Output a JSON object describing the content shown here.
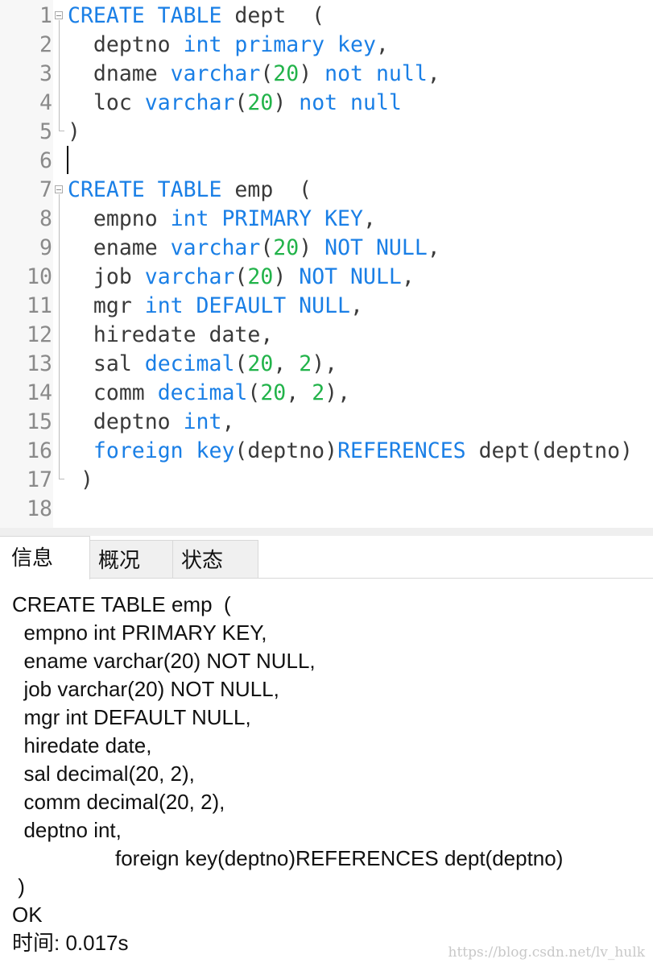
{
  "editor": {
    "lines": [
      [
        [
          "CREATE TABLE",
          "kw"
        ],
        [
          " dept  (",
          ""
        ]
      ],
      [
        [
          "  deptno ",
          ""
        ],
        [
          "int primary key",
          "kw"
        ],
        [
          ",",
          ""
        ]
      ],
      [
        [
          "  dname ",
          ""
        ],
        [
          "varchar",
          "kw"
        ],
        [
          "(",
          ""
        ],
        [
          "20",
          "num"
        ],
        [
          ") ",
          ""
        ],
        [
          "not null",
          "kw"
        ],
        [
          ",",
          ""
        ]
      ],
      [
        [
          "  loc ",
          ""
        ],
        [
          "varchar",
          "kw"
        ],
        [
          "(",
          ""
        ],
        [
          "20",
          "num"
        ],
        [
          ") ",
          ""
        ],
        [
          "not null",
          "kw"
        ]
      ],
      [
        [
          ")",
          ""
        ]
      ],
      [],
      [
        [
          "CREATE TABLE",
          "kw"
        ],
        [
          " emp  (",
          ""
        ]
      ],
      [
        [
          "  empno ",
          ""
        ],
        [
          "int PRIMARY KEY",
          "kw"
        ],
        [
          ",",
          ""
        ]
      ],
      [
        [
          "  ename ",
          ""
        ],
        [
          "varchar",
          "kw"
        ],
        [
          "(",
          ""
        ],
        [
          "20",
          "num"
        ],
        [
          ") ",
          ""
        ],
        [
          "NOT NULL",
          "kw"
        ],
        [
          ",",
          ""
        ]
      ],
      [
        [
          "  job ",
          ""
        ],
        [
          "varchar",
          "kw"
        ],
        [
          "(",
          ""
        ],
        [
          "20",
          "num"
        ],
        [
          ") ",
          ""
        ],
        [
          "NOT NULL",
          "kw"
        ],
        [
          ",",
          ""
        ]
      ],
      [
        [
          "  mgr ",
          ""
        ],
        [
          "int DEFAULT NULL",
          "kw"
        ],
        [
          ",",
          ""
        ]
      ],
      [
        [
          "  hiredate date,",
          ""
        ]
      ],
      [
        [
          "  sal ",
          ""
        ],
        [
          "decimal",
          "kw"
        ],
        [
          "(",
          ""
        ],
        [
          "20",
          "num"
        ],
        [
          ", ",
          ""
        ],
        [
          "2",
          "num"
        ],
        [
          "),",
          ""
        ]
      ],
      [
        [
          "  comm ",
          ""
        ],
        [
          "decimal",
          "kw"
        ],
        [
          "(",
          ""
        ],
        [
          "20",
          "num"
        ],
        [
          ", ",
          ""
        ],
        [
          "2",
          "num"
        ],
        [
          "),",
          ""
        ]
      ],
      [
        [
          "  deptno ",
          ""
        ],
        [
          "int",
          "kw"
        ],
        [
          ",",
          ""
        ]
      ],
      [
        [
          "  ",
          ""
        ],
        [
          "foreign key",
          "kw"
        ],
        [
          "(deptno)",
          ""
        ],
        [
          "REFERENCES",
          "kw"
        ],
        [
          " dept(deptno)",
          ""
        ]
      ],
      [
        [
          " )",
          ""
        ]
      ],
      []
    ],
    "colors": {
      "keyword": "#1a7fe6",
      "number": "#22b34a",
      "text": "#3a3a3a"
    }
  },
  "tabs": [
    {
      "label": "信息",
      "active": true
    },
    {
      "label": "概况",
      "active": false
    },
    {
      "label": "状态",
      "active": false
    }
  ],
  "output": {
    "lines": [
      "CREATE TABLE emp  (",
      "  empno int PRIMARY KEY,",
      "  ename varchar(20) NOT NULL,",
      "  job varchar(20) NOT NULL,",
      "  mgr int DEFAULT NULL,",
      "  hiredate date,",
      "  sal decimal(20, 2),",
      "  comm decimal(20, 2),",
      "  deptno int,",
      "\t\tforeign key(deptno)REFERENCES dept(deptno)",
      " )",
      "OK",
      "时间: 0.017s"
    ]
  },
  "watermark": "https://blog.csdn.net/lv_hulk"
}
